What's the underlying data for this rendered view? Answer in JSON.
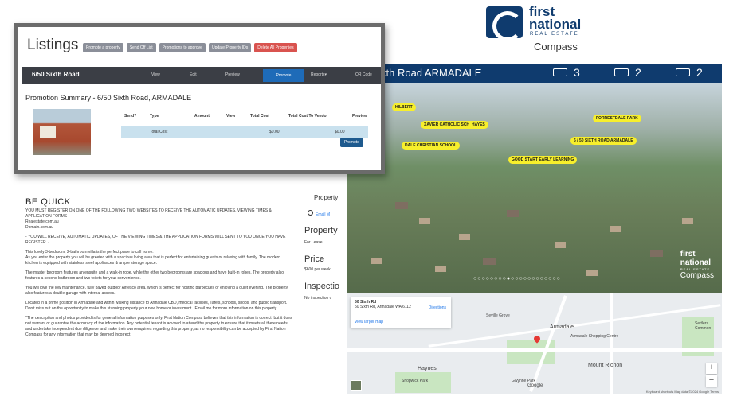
{
  "logo": {
    "line1": "first",
    "line2": "national",
    "line3": "REAL ESTATE",
    "line4": "Compass"
  },
  "property": {
    "title": "xth Road ARMADALE",
    "beds": "3",
    "baths": "2",
    "cars": "2"
  },
  "aerial": {
    "tags": [
      "HILBERT",
      "XAVIER CATHOLIC SCHOOL",
      "HAYES",
      "FORRESTDALE PARK",
      "DALE CHRISTIAN SCHOOL",
      "6 / 50 SIXTH ROAD ARMADALE",
      "GOOD START EARLY LEARNING"
    ],
    "logo_line1": "first",
    "logo_line2": "national",
    "logo_line3": "Compass",
    "logo_re": "REAL ESTATE",
    "dots": "○○○○○○○○●○○○○○○○○○○○○"
  },
  "map": {
    "addr": "50 Sixth Rd",
    "sub": "50 Sixth Rd, Armadale WA 6112",
    "directions": "Directions",
    "larger": "View larger map",
    "labels": [
      "Armadale",
      "Haynes",
      "Mount Richon",
      "Seville Grove",
      "Shopwick Park",
      "Gwynne Park",
      "Armadale Shopping Centre",
      "Settlers Common",
      "Google"
    ],
    "footer": "Keyboard shortcuts   Map data ©2024 Google   Terms"
  },
  "side": {
    "property": "Property",
    "email": "Email M",
    "property2": "Property",
    "for_lease": "For Lease",
    "price": "Price",
    "price_val": "$600 per week",
    "inspection": "Inspectio",
    "inspection_val": "No inspection c"
  },
  "desc": {
    "title": "BE QUICK",
    "p1": "YOU MUST REGISTER ON ONE OF THE FOLLOWING TWO WEBSITES TO RECEIVE THE AUTOMATIC UPDATES, VIEWING TIMES & APPLICATION FORMS -",
    "p1b": "Realestate.com.au",
    "p1c": "Domain.com.au",
    "p2": "- YOU WILL RECEIVE, AUTOMATIC UPDATES, OF THE VIEWING TIMES & THE APPLICATION FORMS WILL SENT TO YOU ONCE YOU HAVE REGISTER. -",
    "p3": "This lovely 3-bedroom, 2-bathroom villa is the perfect place to call home.",
    "p3b": "As you enter the property you will be greeted with a spacious living area that is perfect for entertaining guests or relaxing with family. The modern kitchen is equipped with stainless steel appliances & ample storage space.",
    "p4": "The master bedroom features an ensuite and a walk-in robe, while the other two bedrooms are spacious and have built-in robes. The property also features a second bathroom and two toilets for your convenience.",
    "p5": "You will love the low maintenance, fully paved outdoor Alfresco area, which is perfect for hosting barbecues or enjoying a quiet evening. The property also features a double garage with internal access.",
    "p6": "Located in a prime position in Armadale and within walking distance to Armadale CBD, medical facilities, Tafe's, schools, shops, and public transport. Don't miss out on the opportunity to make this stunning property your new home or investment . Email me for more information on this property.",
    "p7": "*The description and photos provided is for general information purposes only. First Nation Compass believes that this information is correct, but it does not warrant or guarantee the accuracy of the information. Any potential tenant is advised to attend the property to ensure that it meets all there needs and undertake independent due diligence and make their own enquiries regarding this property, as no responsibility can be accepted by First Nation Compass for any information that may be deemed incorrect."
  },
  "admin": {
    "title": "Listings",
    "btns": [
      "Promote a property",
      "Send Off List",
      "Promotions to approve",
      "Update Property IDs",
      "Delete All Properties"
    ],
    "nav_addr": "6/50 Sixth Road",
    "nav": [
      "View",
      "Edit",
      "Preview",
      "Promote",
      "Reports▾",
      "QR Code"
    ],
    "promo_title": "Promotion Summary - 6/50 Sixth Road, ARMADALE",
    "headers": [
      "Send?",
      "Type",
      "Amount",
      "View",
      "Total Cost",
      "Total Cost To Vendor",
      "Preview"
    ],
    "total_label": "Total Cost",
    "total_cost": "$0.00",
    "total_vendor": "$0.00",
    "promote": "Promote"
  }
}
